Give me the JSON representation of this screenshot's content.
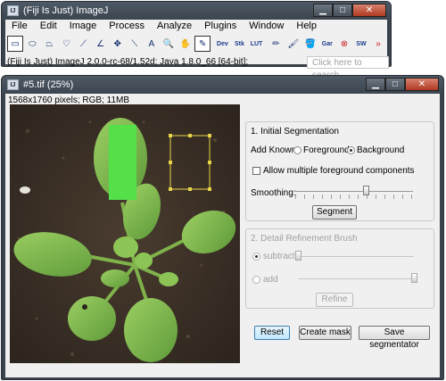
{
  "main_window": {
    "title": "(Fiji Is Just) ImageJ",
    "menus": [
      "File",
      "Edit",
      "Image",
      "Process",
      "Analyze",
      "Plugins",
      "Window",
      "Help"
    ],
    "tools": [
      {
        "name": "rectangle-tool-icon",
        "glyph": "▭",
        "selected": true
      },
      {
        "name": "oval-tool-icon",
        "glyph": "⬭"
      },
      {
        "name": "polygon-tool-icon",
        "glyph": "⏢"
      },
      {
        "name": "freehand-tool-icon",
        "glyph": "♡"
      },
      {
        "name": "line-tool-icon",
        "glyph": "⟋"
      },
      {
        "name": "angle-tool-icon",
        "glyph": "∠"
      },
      {
        "name": "point-tool-icon",
        "glyph": "✥"
      },
      {
        "name": "wand-tool-icon",
        "glyph": "⟍"
      },
      {
        "name": "text-tool-icon",
        "glyph": "A"
      },
      {
        "name": "magnifier-tool-icon",
        "glyph": "🔍"
      },
      {
        "name": "hand-tool-icon",
        "glyph": "✋"
      },
      {
        "name": "color-picker-tool-icon",
        "glyph": "✎",
        "selected": true
      },
      {
        "name": "dev-tool-icon",
        "text": "Dev"
      },
      {
        "name": "stack-tool-icon",
        "text": "Stk"
      },
      {
        "name": "lut-tool-icon",
        "text": "LUT"
      },
      {
        "name": "pencil-tool-icon",
        "glyph": "✏"
      },
      {
        "name": "brush-tool-icon",
        "glyph": "🖌"
      },
      {
        "name": "flood-fill-tool-icon",
        "glyph": "🪣"
      },
      {
        "name": "gar-tool-icon",
        "text": "Gar"
      },
      {
        "name": "stop-tool-icon",
        "glyph": "⊗",
        "color": "#cc2020"
      },
      {
        "name": "sync-tool-icon",
        "text": "SW"
      },
      {
        "name": "more-tools-icon",
        "glyph": "»",
        "color": "#cc2020"
      }
    ],
    "status": "(Fiji Is Just) ImageJ 2.0.0-rc-68/1.52d; Java 1.8.0_66 [64-bit];",
    "search_placeholder": "Click here to search"
  },
  "image_window": {
    "title": "#5.tif (25%)",
    "info": "1568x1760 pixels; RGB; 11MB"
  },
  "segmentation": {
    "section1_title": "1. Initial Segmentation",
    "add_known_label": "Add Known",
    "foreground_label": "Foreground",
    "background_label": "Background",
    "selected_known": "Background",
    "multiple_fg_label": "Allow multiple foreground components",
    "multiple_fg_checked": false,
    "smoothing_label": "Smoothing:",
    "smoothing_value": 0.6,
    "segment_button": "Segment",
    "section2_title": "2. Detail Refinement Brush",
    "subtract_label": "subtract",
    "add_label": "add",
    "subtract_value": 0.0,
    "add_value": 1.0,
    "refine_button": "Refine",
    "reset_button": "Reset",
    "create_mask_button": "Create mask",
    "save_button": "Save segmentator"
  },
  "window_controls": {
    "minimize": "▁",
    "maximize": "□",
    "close": "✕"
  },
  "colors": {
    "accent_green": "#55e04a",
    "selection_yellow": "#e8d44a",
    "titlebar": "#3a434d"
  }
}
